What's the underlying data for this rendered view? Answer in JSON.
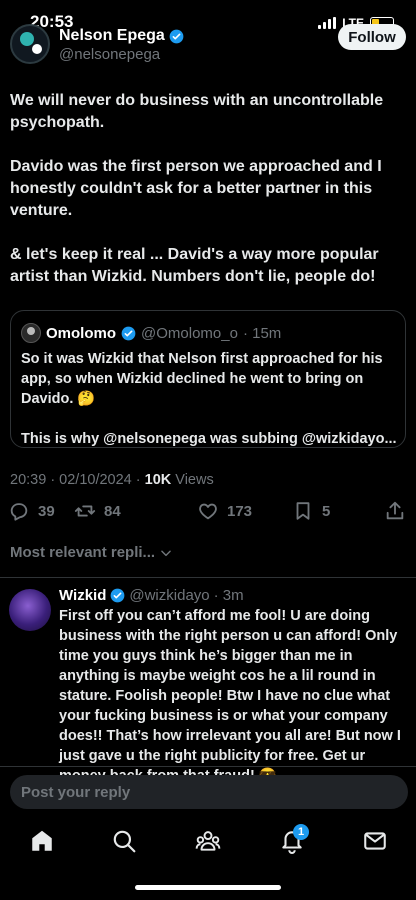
{
  "status_bar": {
    "time": "20:53",
    "network": "LTE"
  },
  "header": {
    "name": "Nelson Epega",
    "handle": "@nelsonepega",
    "follow_label": "Follow"
  },
  "tweet": {
    "paragraphs": [
      "We will never do business with an uncontrollable psychopath.",
      "Davido was the first person we approached and I honestly couldn't ask for a better partner in this venture.",
      "& let's keep it real ... David's a way more popular artist than Wizkid. Numbers don't lie, people do!"
    ]
  },
  "quote": {
    "name": "Omolomo",
    "handle": "@Omolomo_o",
    "time": "· 15m",
    "paragraphs": [
      "So it was Wizkid that Nelson first approached for his app, so when Wizkid declined he went to bring on Davido. 🤔",
      "This is why @nelsonepega was subbing @wizkidayo..."
    ]
  },
  "meta": {
    "timestamp": "20:39 · 02/10/2024 · ",
    "views_count": "10K",
    "views_label": " Views"
  },
  "actions": {
    "replies": "39",
    "reposts": "84",
    "likes": "173",
    "bookmarks": "5"
  },
  "sort_label": "Most relevant repli...",
  "reply": {
    "name": "Wizkid",
    "handle": "@wizkidayo",
    "time": "· 3m",
    "text": "First off you can’t afford me fool! U are doing business with the right person u can afford! Only time you guys think he’s bigger than me in anything is maybe weight cos he a lil round in stature. Foolish people! Btw I have no clue what your fucking business is or what your company does!! That’s how irrelevant you all are! But now I just gave u the right publicity for free. Get ur money back from that fraud! 😎"
  },
  "composer": {
    "placeholder": "Post your reply"
  },
  "nav": {
    "items": [
      "home-icon",
      "search-icon",
      "communities-icon",
      "notifications-icon",
      "messages-icon"
    ],
    "notifications_badge": "1"
  },
  "colors": {
    "accent": "#1d9bf0",
    "background": "#000000",
    "muted": "#71767b"
  }
}
